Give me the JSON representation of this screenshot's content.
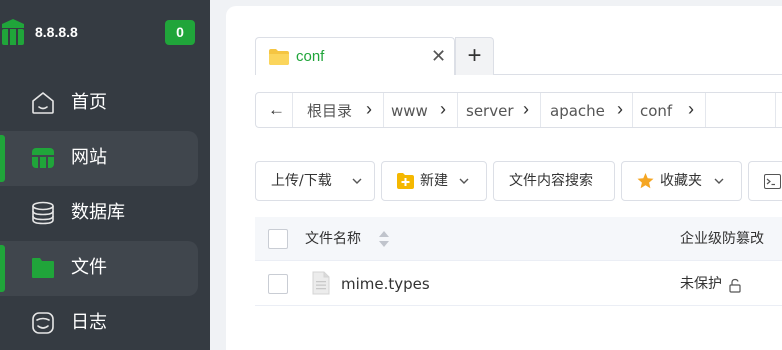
{
  "sidebar": {
    "host": "8.8.8.8",
    "badge": "0",
    "items": [
      {
        "label": "首页",
        "icon": "home-icon",
        "active": false
      },
      {
        "label": "网站",
        "icon": "website-icon",
        "active": true
      },
      {
        "label": "数据库",
        "icon": "database-icon",
        "active": false
      },
      {
        "label": "文件",
        "icon": "folder-icon",
        "active": true
      },
      {
        "label": "日志",
        "icon": "log-icon",
        "active": false
      }
    ]
  },
  "tabs": [
    {
      "label": "conf",
      "icon": "folder-icon",
      "active": true
    }
  ],
  "breadcrumb": [
    "根目录",
    "www",
    "server",
    "apache",
    "conf"
  ],
  "toolbar": {
    "upload": "上传/下载",
    "new": "新建",
    "search": "文件内容搜索",
    "favorites": "收藏夹"
  },
  "table": {
    "columns": [
      "文件名称",
      "企业级防篡改"
    ],
    "rows": [
      {
        "name": "mime.types",
        "protection": "未保护"
      }
    ]
  },
  "colors": {
    "accent": "#20a53a",
    "sidebar_bg": "#353b42"
  }
}
